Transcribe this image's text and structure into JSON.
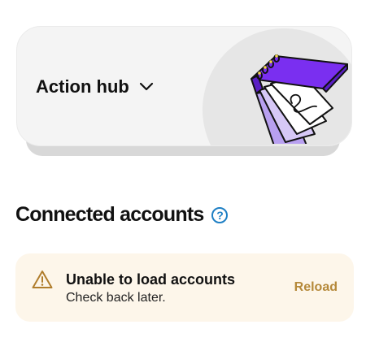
{
  "hub": {
    "title": "Action hub",
    "chevron_icon": "chevron-down-icon",
    "illustration": "notebook-illustration"
  },
  "accounts_section": {
    "title": "Connected accounts",
    "help_icon_glyph": "?"
  },
  "alert": {
    "icon": "warning-triangle-icon",
    "title": "Unable to load accounts",
    "message": "Check back later.",
    "action_label": "Reload"
  },
  "colors": {
    "accent_blue": "#1e7fc4",
    "alert_background": "#fdf6ea",
    "alert_action": "#b5893a",
    "notebook_purple": "#7a2ff0"
  }
}
